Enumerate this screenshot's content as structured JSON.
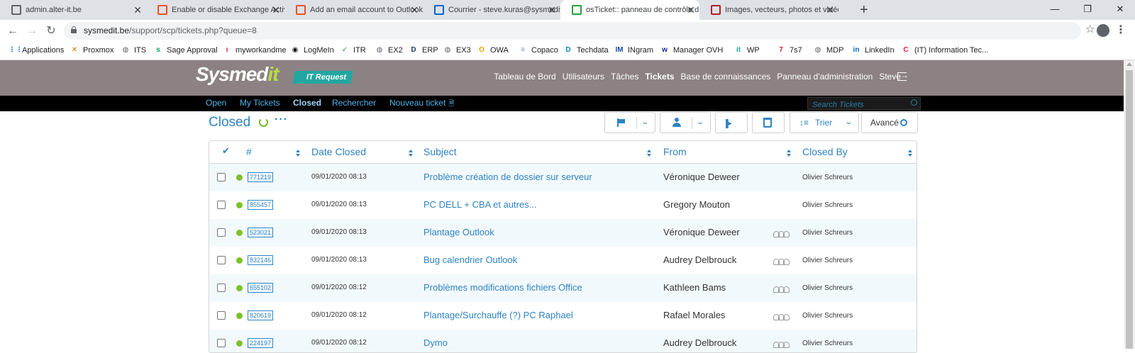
{
  "browser": {
    "tabs": [
      {
        "title": "admin.alter-it.be",
        "icon": "globe-icon",
        "color": "#5f6368"
      },
      {
        "title": "Enable or disable Exchange Activ",
        "icon": "microsoft-icon",
        "color": "#f25022"
      },
      {
        "title": "Add an email account to Outlook",
        "icon": "microsoft-icon",
        "color": "#f25022"
      },
      {
        "title": "Courrier - steve.kuras@sysmedit.",
        "icon": "outlook-icon",
        "color": "#0a64c8"
      },
      {
        "title": "osTicket:: panneau de contrôle d",
        "icon": "check-icon",
        "color": "#2a9d3a"
      },
      {
        "title": "Images, vecteurs, photos et vidéo",
        "icon": "shutterstock-icon",
        "color": "#b21f2d"
      }
    ],
    "close_glyph": "✕",
    "new_tab_glyph": "+",
    "window": {
      "minimize": "—",
      "restore": "❐",
      "close": "✕"
    },
    "url_host": "sysmedit.be",
    "url_path": "/support/scp/tickets.php?queue=8",
    "nav": {
      "back": "←",
      "forward": "→",
      "reload": "↻"
    },
    "star_glyph": "☆",
    "menu_glyph": "⋮",
    "bookmarks": [
      {
        "label": "Applications",
        "icon": "apps-grid-icon",
        "glyph": "⋮⋮",
        "color": "#4285f4"
      },
      {
        "label": "Proxmox",
        "icon": "proxmox-icon",
        "glyph": "✕",
        "color": "#e57000"
      },
      {
        "label": "ITS",
        "icon": "globe-icon",
        "glyph": "◍",
        "color": "#5f6368"
      },
      {
        "label": "Sage Approval",
        "icon": "sage-icon",
        "glyph": "s",
        "color": "#00a651"
      },
      {
        "label": "myworkandme",
        "icon": "myworkandme-icon",
        "glyph": "ı",
        "color": "#d9202f"
      },
      {
        "label": "LogMeIn",
        "icon": "logmein-icon",
        "glyph": "◉",
        "color": "#111111"
      },
      {
        "label": "ITR",
        "icon": "check-icon",
        "glyph": "✓",
        "color": "#2a9d3a"
      },
      {
        "label": "EX2",
        "icon": "globe-icon",
        "glyph": "◍",
        "color": "#5f6368"
      },
      {
        "label": "ERP",
        "icon": "erp-icon",
        "glyph": "D",
        "color": "#1f3a6b"
      },
      {
        "label": "EX3",
        "icon": "globe-icon",
        "glyph": "◍",
        "color": "#5f6368"
      },
      {
        "label": "OWA",
        "icon": "owa-icon",
        "glyph": "O",
        "color": "#f4a100"
      },
      {
        "label": "Copaco",
        "icon": "copaco-icon",
        "glyph": "≡",
        "color": "#6a8fc4"
      },
      {
        "label": "Techdata",
        "icon": "techdata-icon",
        "glyph": "D",
        "color": "#0a7ec2"
      },
      {
        "label": "INgram",
        "icon": "ingram-icon",
        "glyph": "IM",
        "color": "#1c4aa8"
      },
      {
        "label": "Manager OVH",
        "icon": "ovh-icon",
        "glyph": "w",
        "color": "#12239e"
      },
      {
        "label": "WP",
        "icon": "it-icon",
        "glyph": "it",
        "color": "#23a6a1"
      },
      {
        "label": "7s7",
        "icon": "7s7-icon",
        "glyph": "7",
        "color": "#d9202f"
      },
      {
        "label": "MDP",
        "icon": "globe-icon",
        "glyph": "◍",
        "color": "#5f6368"
      },
      {
        "label": "LinkedIn",
        "icon": "linkedin-icon",
        "glyph": "in",
        "color": "#0a66c2"
      },
      {
        "label": "(IT) Information Tec...",
        "icon": "c-icon",
        "glyph": "C",
        "color": "#d9202f"
      }
    ]
  },
  "app": {
    "logo_main": "Sysmed",
    "logo_it": "it",
    "logo_badge": "IT Request",
    "nav": [
      {
        "label": "Tableau de Bord",
        "current": false
      },
      {
        "label": "Utilisateurs",
        "current": false
      },
      {
        "label": "Tâches",
        "current": false
      },
      {
        "label": "Tickets",
        "current": true
      },
      {
        "label": "Base de connaissances",
        "current": false
      },
      {
        "label": "Panneau d'administration",
        "current": false
      },
      {
        "label": "Steve",
        "current": false
      }
    ],
    "subnav": [
      {
        "label": "Open",
        "current": false
      },
      {
        "label": "My Tickets",
        "current": false
      },
      {
        "label": "Closed",
        "current": true
      },
      {
        "label": "Rechercher",
        "current": false
      },
      {
        "label": "Nouveau ticket",
        "current": false
      }
    ],
    "new_ticket_glyph": "🗎",
    "search_placeholder": "Search Tickets"
  },
  "page": {
    "title": "Closed",
    "more_glyph": "···",
    "toolbar": {
      "sort_label": "Trier",
      "advanced_label": "Avancé",
      "chevron": "⌄"
    },
    "columns": {
      "check": "✔",
      "number": "#",
      "date_closed": "Date Closed",
      "subject": "Subject",
      "from": "From",
      "closed_by": "Closed By"
    },
    "rows": [
      {
        "number": "771219",
        "date": "09/01/2020 08:13",
        "subject": "Problème création de dossier sur serveur",
        "from": "Véronique Deweer",
        "collaborators": false,
        "closed_by": "Olivier Schreurs"
      },
      {
        "number": "855457",
        "date": "09/01/2020 08:13",
        "subject": "PC DELL + CBA et autres...",
        "from": "Gregory Mouton",
        "collaborators": false,
        "closed_by": "Olivier Schreurs"
      },
      {
        "number": "523021",
        "date": "09/01/2020 08:13",
        "subject": "Plantage Outlook",
        "from": "Véronique Deweer",
        "collaborators": true,
        "closed_by": "Olivier Schreurs"
      },
      {
        "number": "832146",
        "date": "09/01/2020 08:13",
        "subject": "Bug calendrier Outlook",
        "from": "Audrey Delbrouck",
        "collaborators": true,
        "closed_by": "Olivier Schreurs"
      },
      {
        "number": "655102",
        "date": "09/01/2020 08:12",
        "subject": "Problèmes modifications fichiers Office",
        "from": "Kathleen Bams",
        "collaborators": true,
        "closed_by": "Olivier Schreurs"
      },
      {
        "number": "820619",
        "date": "09/01/2020 08:12",
        "subject": "Plantage/Surchauffe (?) PC Raphael",
        "from": "Rafael Morales",
        "collaborators": true,
        "closed_by": "Olivier Schreurs"
      },
      {
        "number": "224197",
        "date": "09/01/2020 08:12",
        "subject": "Dymo",
        "from": "Audrey Delbrouck",
        "collaborators": true,
        "closed_by": "Olivier Schreurs"
      }
    ],
    "status_color": "#7ec12a",
    "accent_color": "#2e83c4"
  }
}
